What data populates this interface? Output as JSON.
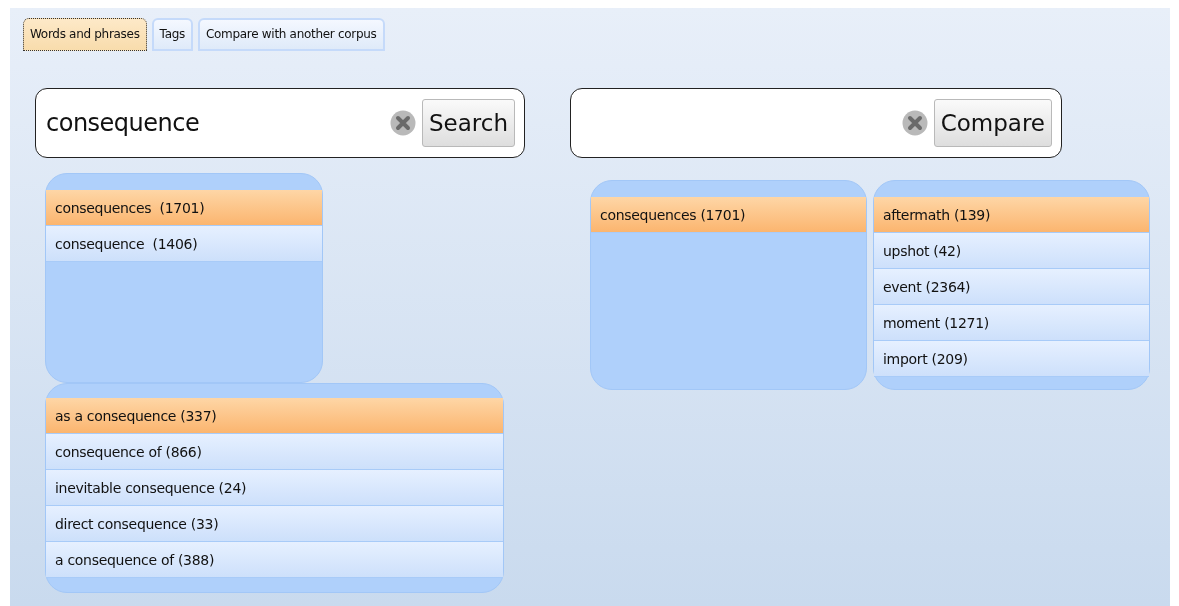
{
  "tabs": [
    {
      "label": "Words and phrases",
      "selected": true
    },
    {
      "label": "Tags",
      "selected": false
    },
    {
      "label": "Compare with another corpus",
      "selected": false
    }
  ],
  "search": {
    "value": "consequence",
    "button": "Search"
  },
  "word_list": [
    {
      "label": "consequences  (1701)",
      "selected": true
    },
    {
      "label": "consequence  (1406)",
      "selected": false
    }
  ],
  "phrase_list": [
    {
      "label": "as a consequence (337)",
      "selected": true
    },
    {
      "label": "consequence of (866)",
      "selected": false
    },
    {
      "label": "inevitable consequence (24)",
      "selected": false
    },
    {
      "label": "direct consequence (33)",
      "selected": false
    },
    {
      "label": "a consequence of (388)",
      "selected": false
    }
  ],
  "compare": {
    "button": "Compare"
  },
  "compare_lists": [
    {
      "items": [
        {
          "label": "consequences (1701)",
          "selected": true
        }
      ]
    },
    {
      "items": [
        {
          "label": "aftermath (139)",
          "selected": true
        },
        {
          "label": "upshot (42)",
          "selected": false
        },
        {
          "label": "event (2364)",
          "selected": false
        },
        {
          "label": "moment (1271)",
          "selected": false
        },
        {
          "label": "import (209)",
          "selected": false
        }
      ]
    }
  ]
}
